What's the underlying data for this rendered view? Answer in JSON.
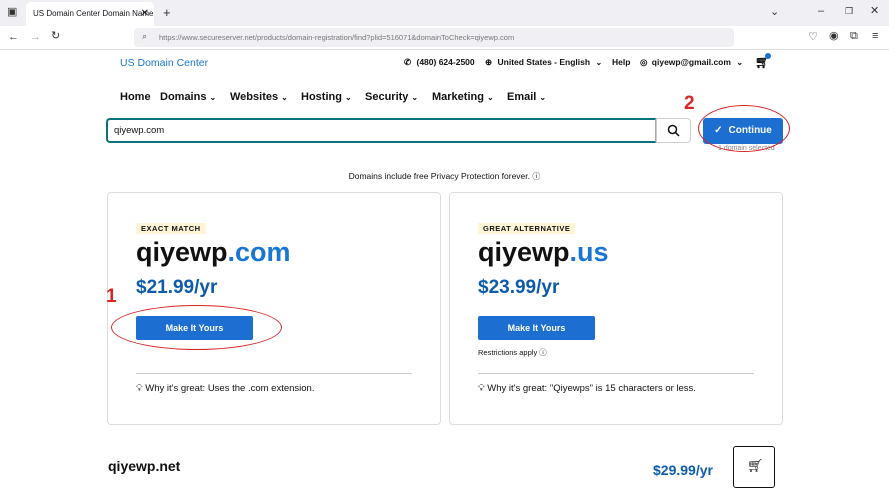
{
  "browser": {
    "tab_title": "US Domain Center Domain Name S",
    "tab_close": "✕",
    "new_tab": "+",
    "url": "https://www.secureserver.net/products/domain-registration/find?plid=516071&domainToCheck=qiyewp.com",
    "url_host": "secureserver.net"
  },
  "header": {
    "brand": "US Domain Center",
    "phone": "(480) 624-2500",
    "region": "United States - English",
    "help": "Help",
    "account": "qiyewp@gmail.com"
  },
  "nav": [
    "Home",
    "Domains",
    "Websites",
    "Hosting",
    "Security",
    "Marketing",
    "Email"
  ],
  "search": {
    "value": "qiyewp.com",
    "continue_label": "Continue",
    "subnote": "1 domain selected"
  },
  "privacy_note": "Domains include free Privacy Protection forever.",
  "cards": [
    {
      "badge": "EXACT MATCH",
      "name": "qiyewp",
      "tld": ".com",
      "price": "$21.99/yr",
      "button": "Make It Yours",
      "note": "",
      "why": "Why it's great: Uses the .com extension."
    },
    {
      "badge": "GREAT ALTERNATIVE",
      "name": "qiyewp",
      "tld": ".us",
      "price": "$23.99/yr",
      "button": "Make It Yours",
      "note": "Restrictions apply",
      "why": "Why it's great: \"Qiyewps\" is 15 characters or less."
    }
  ],
  "more": {
    "domain": "qiyewp.net",
    "price": "$29.99/yr"
  },
  "annotations": {
    "label_1": "1",
    "label_2": "2",
    "color": "#d92525"
  },
  "colors": {
    "accent": "#1c6fd1",
    "price": "#0d5cab",
    "search_border": "#09757a"
  }
}
